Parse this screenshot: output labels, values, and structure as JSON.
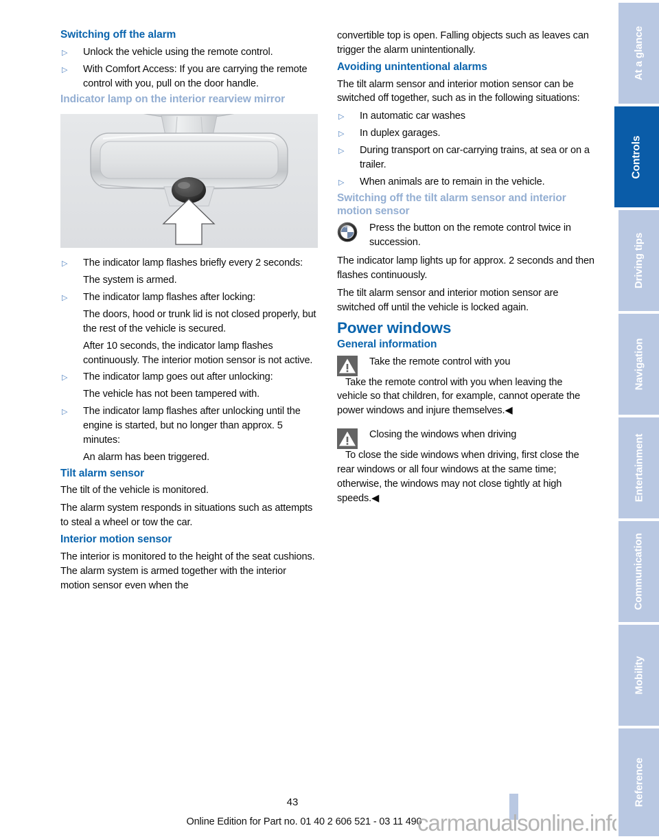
{
  "document": {
    "page_number": "43",
    "footer_text": "Online Edition for Part no. 01 40 2 606 521 - 03 11 490",
    "watermark": "carmanualsonline.info"
  },
  "colors": {
    "heading_blue": "#0a64ad",
    "heading_muted_blue": "#93aed2",
    "tab_inactive": "#b9c8e2",
    "tab_active": "#0a5ca8",
    "bullet_marker": "#4c7fbe",
    "figure_background": "#e2e4e6",
    "warning_icon_background": "#636363"
  },
  "left_column": {
    "heading_1": "Switching off the alarm",
    "bullets_1": [
      "Unlock the vehicle using the remote control.",
      "With Comfort Access: If you are carrying the remote control with you, pull on the door handle."
    ],
    "heading_2": "Indicator lamp on the interior rearview mirror",
    "figure_alt": "interior-rearview-mirror-with-indicator-lamp",
    "bullets_2": [
      {
        "text": "The indicator lamp flashes briefly every 2 seconds:",
        "continuations": [
          "The system is armed."
        ]
      },
      {
        "text": "The indicator lamp flashes after locking:",
        "continuations": [
          "The doors, hood or trunk lid is not closed properly, but the rest of the vehicle is secured.",
          "After 10 seconds, the indicator lamp flashes continuously. The interior motion sensor is not active."
        ]
      },
      {
        "text": "The indicator lamp goes out after unlocking:",
        "continuations": [
          "The vehicle has not been tampered with."
        ]
      },
      {
        "text": "The indicator lamp flashes after unlocking until the engine is started, but no longer than approx. 5 minutes:",
        "continuations": [
          "An alarm has been triggered."
        ]
      }
    ],
    "heading_3": "Tilt alarm sensor",
    "paragraphs_3": [
      "The tilt of the vehicle is monitored.",
      "The alarm system responds in situations such as attempts to steal a wheel or tow the car."
    ],
    "heading_4": "Interior motion sensor",
    "paragraphs_4": [
      "The interior is monitored to the height of the seat cushions. The alarm system is armed together with the interior motion sensor even when the"
    ]
  },
  "right_column": {
    "continuation_paragraph": "convertible top is open. Falling objects such as leaves can trigger the alarm unintentionally.",
    "heading_1": "Avoiding unintentional alarms",
    "paragraph_1": "The tilt alarm sensor and interior motion sensor can be switched off together, such as in the following situations:",
    "bullets_1": [
      "In automatic car washes",
      "In duplex garages.",
      "During transport on car-carrying trains, at sea or on a trailer.",
      "When animals are to remain in the vehicle."
    ],
    "heading_2": "Switching off the tilt alarm sensor and interior motion sensor",
    "step_icon": "bmw-roundel-icon",
    "step_text": "Press the button on the remote control twice in succession.",
    "paragraphs_2": [
      "The indicator lamp lights up for approx. 2 seconds and then flashes continuously.",
      "The tilt alarm sensor and interior motion sensor are switched off until the vehicle is locked again."
    ],
    "chapter_title": "Power windows",
    "heading_3": "General information",
    "warnings": [
      {
        "icon": "warning-triangle-icon",
        "title": "Take the remote control with you",
        "body": "Take the remote control with you when leaving the vehicle so that children, for example, cannot operate the power windows and injure themselves.◀"
      },
      {
        "icon": "warning-triangle-icon",
        "title": "Closing the windows when driving",
        "body": "To close the side windows when driving, first close the rear windows or all four windows at the same time; otherwise, the windows may not close tightly at high speeds.◀"
      }
    ]
  },
  "sidebar": {
    "tabs": [
      {
        "label": "At a glance",
        "active": false
      },
      {
        "label": "Controls",
        "active": true
      },
      {
        "label": "Driving tips",
        "active": false
      },
      {
        "label": "Navigation",
        "active": false
      },
      {
        "label": "Entertainment",
        "active": false
      },
      {
        "label": "Communication",
        "active": false
      },
      {
        "label": "Mobility",
        "active": false
      },
      {
        "label": "Reference",
        "active": false
      }
    ]
  }
}
